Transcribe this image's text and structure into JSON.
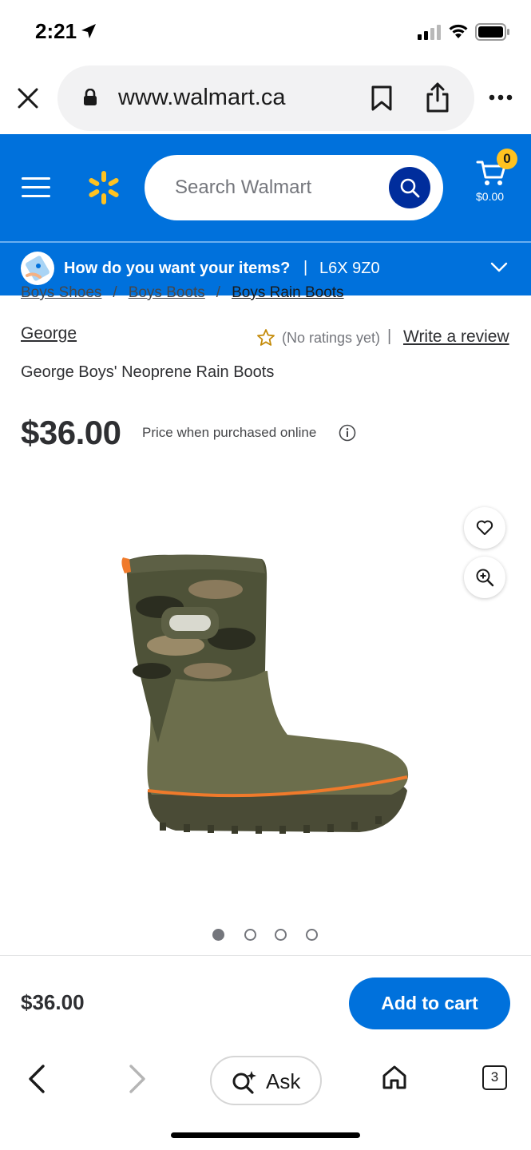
{
  "status_bar": {
    "time": "2:21"
  },
  "browser": {
    "url": "www.walmart.ca"
  },
  "header": {
    "search_placeholder": "Search Walmart",
    "cart_count": "0",
    "cart_total": "$0.00",
    "brand_blue": "#0071dc",
    "spark_yellow": "#ffc220"
  },
  "delivery": {
    "question": "How do you want your items?",
    "separator": "|",
    "postal_code": "L6X 9Z0"
  },
  "breadcrumb": {
    "items": [
      "Boys Shoes",
      "Boys Boots",
      "Boys Rain Boots"
    ],
    "separator": "/"
  },
  "product": {
    "brand": "George",
    "rating_text": "(No ratings yet)",
    "rating_sep": "|",
    "review_link": "Write a review",
    "title": "George Boys' Neoprene Rain Boots",
    "price": "$36.00",
    "price_note": "Price when purchased online",
    "image_count": 4,
    "active_image": 1
  },
  "sticky": {
    "price": "$36.00",
    "add_to_cart": "Add to cart"
  },
  "toolbar": {
    "ask_label": "Ask",
    "tab_count": "3"
  }
}
